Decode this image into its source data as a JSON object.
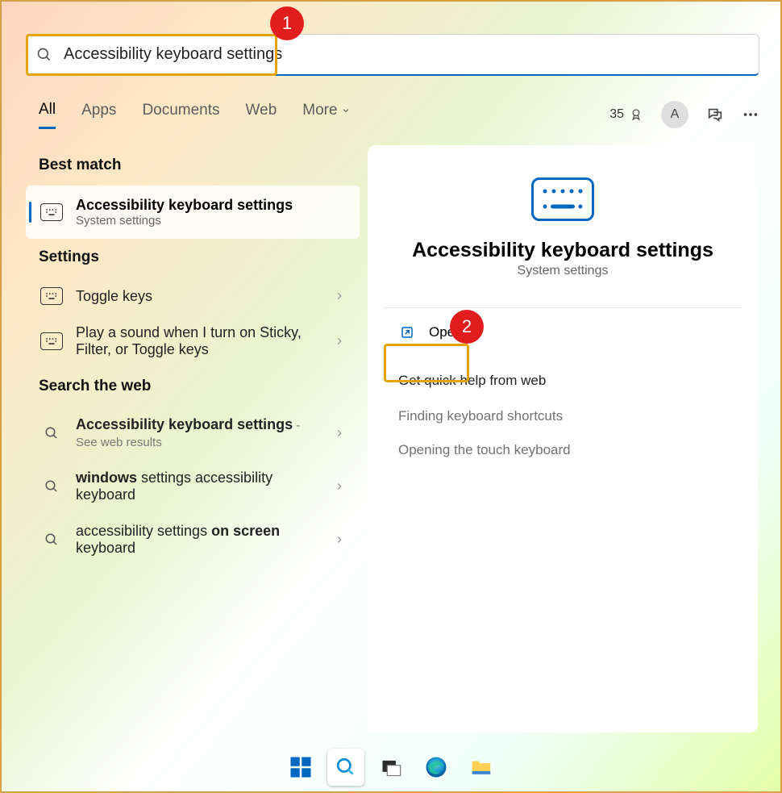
{
  "search": {
    "value": "Accessibility keyboard settings"
  },
  "annotations": {
    "step1": "1",
    "step2": "2"
  },
  "tabs": {
    "all": "All",
    "apps": "Apps",
    "documents": "Documents",
    "web": "Web",
    "more": "More"
  },
  "header_right": {
    "points": "35",
    "avatar_letter": "A"
  },
  "sections": {
    "best_match": "Best match",
    "settings": "Settings",
    "search_web": "Search the web"
  },
  "best": {
    "title": "Accessibility keyboard settings",
    "subtitle": "System settings"
  },
  "settings_rows": [
    {
      "label": "Toggle keys"
    },
    {
      "label": "Play a sound when I turn on Sticky, Filter, or Toggle keys"
    }
  ],
  "web_rows": [
    {
      "bold": "Accessibility keyboard settings",
      "rest": " - See web results"
    },
    {
      "bold": "windows",
      "rest": " settings accessibility keyboard"
    },
    {
      "pre": "accessibility settings ",
      "bold": "on screen",
      "rest": " keyboard"
    }
  ],
  "detail": {
    "title": "Accessibility keyboard settings",
    "subtitle": "System settings",
    "open": "Open",
    "help_header": "Get quick help from web",
    "links": [
      "Finding keyboard shortcuts",
      "Opening the touch keyboard"
    ]
  },
  "colors": {
    "accent": "#0067c0",
    "highlight": "#e3a400",
    "badge": "#e21d1d"
  }
}
